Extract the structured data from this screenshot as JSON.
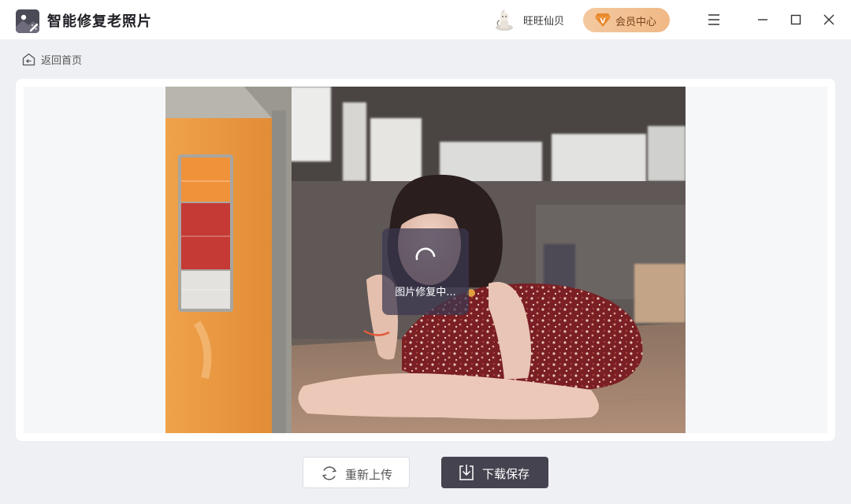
{
  "app": {
    "title": "智能修复老照片",
    "logo_icon": "photo-magic-icon"
  },
  "header": {
    "user_name": "旺旺仙贝",
    "vip_label": "会员中心",
    "vip_badge": "V",
    "menu_icon": "menu-icon",
    "minimize_icon": "minimize-icon",
    "maximize_icon": "maximize-icon",
    "close_icon": "close-icon"
  },
  "nav": {
    "back_label": "返回首页",
    "back_icon": "home-icon"
  },
  "preview": {
    "status_text": "图片修复中...",
    "spinner_icon": "loading-spinner-icon"
  },
  "actions": {
    "reupload_label": "重新上传",
    "reupload_icon": "refresh-icon",
    "download_label": "下载保存",
    "download_icon": "download-icon"
  },
  "colors": {
    "accent_dark": "#45434f",
    "vip_gradient_start": "#f4c9a0",
    "vip_gradient_end": "#f0b886",
    "background": "#eef0f4"
  }
}
